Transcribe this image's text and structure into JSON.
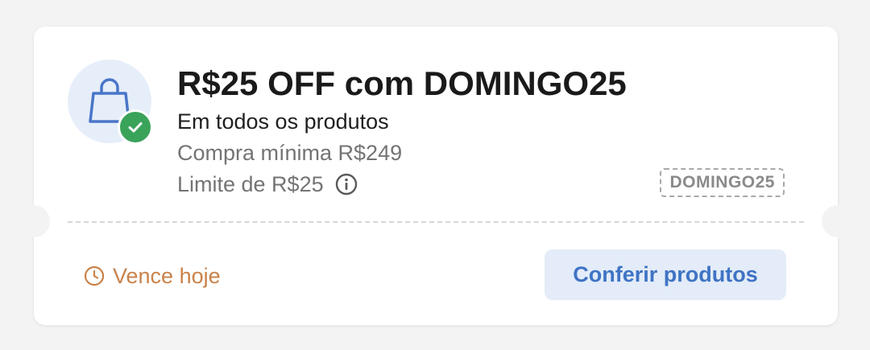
{
  "coupon": {
    "title": "R$25 OFF com DOMINGO25",
    "subtitle": "Em todos os produtos",
    "min_purchase": "Compra mínima R$249",
    "limit": "Limite de R$25",
    "code": "DOMINGO25",
    "expiry": "Vence hoje",
    "cta_label": "Conferir produtos",
    "icons": {
      "main": "shopping-bag-icon",
      "badge": "check-icon",
      "info": "info-icon",
      "expiry": "clock-icon"
    }
  },
  "colors": {
    "background": "#f3f3f3",
    "card": "#ffffff",
    "icon_circle": "#e6eef9",
    "bag_stroke": "#4a76c9",
    "check_badge": "#3aa35a",
    "title": "#1a1a1a",
    "muted_text": "#747474",
    "expiry_orange": "#c9824a",
    "cta_bg": "#e3ecf8",
    "cta_text": "#3f73c4"
  }
}
